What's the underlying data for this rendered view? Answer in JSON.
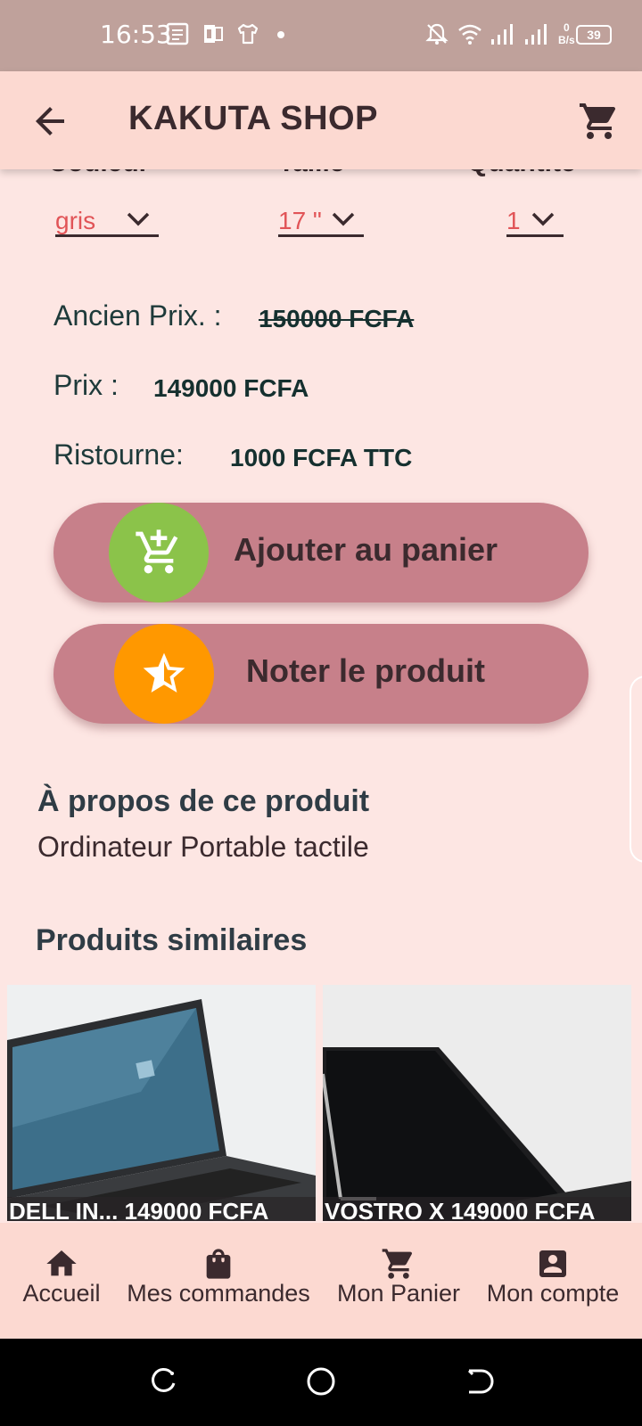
{
  "status_bar": {
    "time": "16:53",
    "network_speed_value": "0",
    "network_speed_unit": "B/s",
    "battery": "39",
    "icons": [
      "news-icon",
      "office-icon",
      "shirt-icon",
      "dot-icon",
      "mute-icon",
      "wifi-icon",
      "signal-icon",
      "signal-icon"
    ]
  },
  "header": {
    "title": "KAKUTA SHOP",
    "back_icon": "arrow-back-icon",
    "cart_icon": "cart-icon"
  },
  "selectors": {
    "color_label": "Couleur",
    "color_value": "gris",
    "size_label": "Taille",
    "size_value": "17 \"",
    "quantity_label": "Quantité",
    "quantity_value": "1"
  },
  "pricing": {
    "old_price_label": "Ancien Prix. :",
    "old_price_value": "150000 FCFA",
    "price_label": "Prix :",
    "price_value": "149000 FCFA",
    "discount_label": "Ristourne:",
    "discount_value": "1000 FCFA TTC"
  },
  "actions": {
    "add_to_cart_label": "Ajouter au panier",
    "rate_product_label": "Noter le  produit"
  },
  "about": {
    "title": "À propos de ce produit",
    "description": "Ordinateur Portable tactile"
  },
  "similar": {
    "title": "Produits similaires",
    "items": [
      {
        "caption": "DELL IN... 149000 FCFA"
      },
      {
        "caption": "VOSTRO X 149000 FCFA"
      }
    ]
  },
  "bottom_nav": {
    "items": [
      {
        "label": "Accueil",
        "icon": "home-icon"
      },
      {
        "label": "Mes commandes",
        "icon": "shopping-bag-icon"
      },
      {
        "label": "Mon Panier",
        "icon": "cart-icon"
      },
      {
        "label": "Mon compte",
        "icon": "account-icon"
      }
    ]
  },
  "colors": {
    "header_bg": "#fcd9d1",
    "page_bg": "#fde6e3",
    "button_bg": "#c7808a",
    "add_cart_circle": "#8bc34a",
    "rate_circle": "#ff9800",
    "dropdown_value": "#e15457",
    "dark_text": "#3b2a2e"
  }
}
